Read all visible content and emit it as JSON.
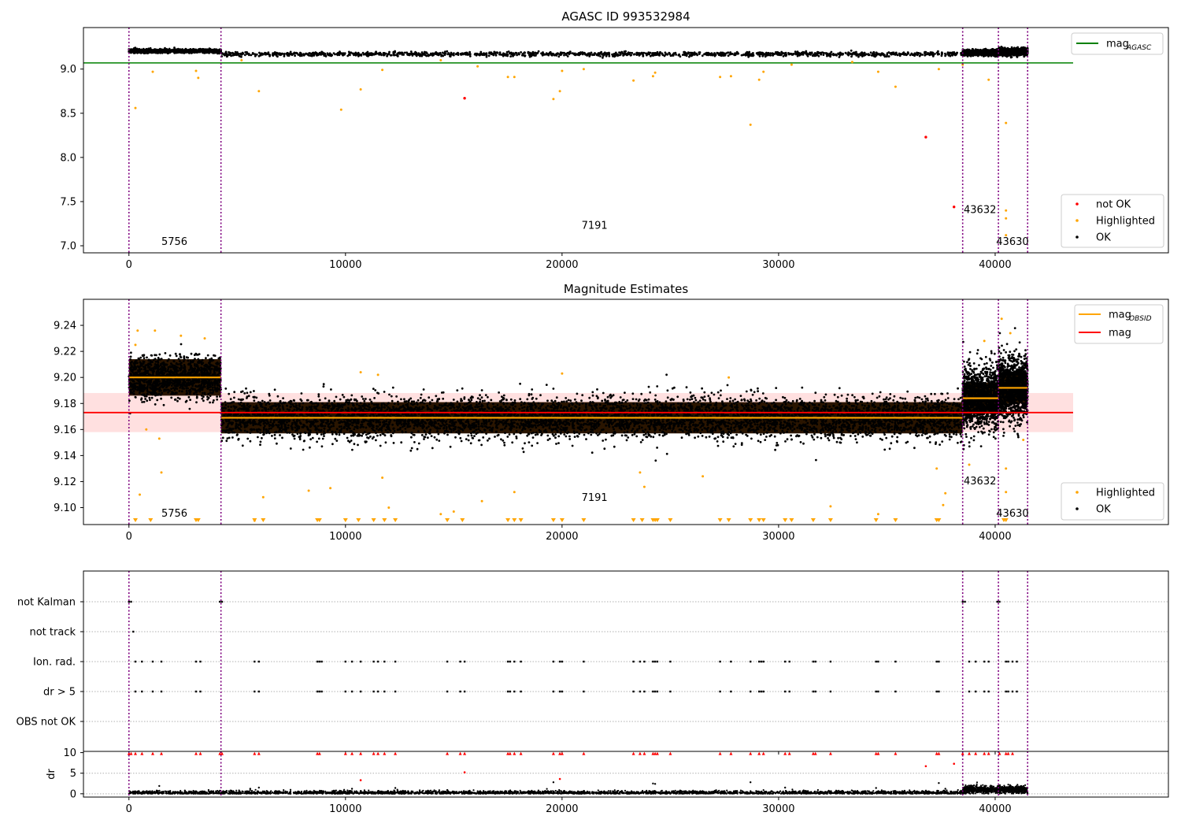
{
  "chart_data": [
    {
      "type": "scatter",
      "title": "AGASC ID 993532984",
      "xlim": [
        -2100,
        48000
      ],
      "ylim": [
        6.92,
        9.47
      ],
      "x_ticks": [
        0,
        10000,
        20000,
        30000,
        40000
      ],
      "y_ticks": [
        7.0,
        7.5,
        8.0,
        8.5,
        9.0
      ],
      "y_tick_format": 1,
      "grid": false,
      "legend_placement": [
        "upper-right",
        "lower-right"
      ],
      "obs_boundaries": [
        0,
        4250,
        38500,
        40150,
        41500
      ],
      "obs_labels": [
        {
          "text": "5756",
          "x": 2100,
          "y": 7.01
        },
        {
          "text": "7191",
          "x": 21500,
          "y": 7.19
        },
        {
          "text": "43632",
          "x": 39300,
          "y": 7.37
        },
        {
          "text": "43630",
          "x": 40800,
          "y": 7.01
        }
      ],
      "reference_lines": [
        {
          "name": "mag",
          "sub": "AGASC",
          "value": 9.07,
          "color": "#008000",
          "x_range": [
            -2100,
            43600
          ]
        }
      ],
      "segments": [
        {
          "x0": 0,
          "x1": 4250,
          "level": 9.205,
          "spread": 0.01
        },
        {
          "x0": 4250,
          "x1": 38500,
          "level": 9.17,
          "spread": 0.012
        },
        {
          "x0": 38500,
          "x1": 40150,
          "level": 9.185,
          "spread": 0.015
        },
        {
          "x0": 40150,
          "x1": 41500,
          "level": 9.195,
          "spread": 0.018
        }
      ],
      "highlighted_points": [
        [
          300,
          8.56
        ],
        [
          1100,
          8.97
        ],
        [
          3100,
          8.98
        ],
        [
          3200,
          8.9
        ],
        [
          5200,
          9.1
        ],
        [
          6000,
          8.75
        ],
        [
          9800,
          8.54
        ],
        [
          10700,
          8.77
        ],
        [
          11700,
          8.99
        ],
        [
          14400,
          9.1
        ],
        [
          16100,
          9.03
        ],
        [
          17500,
          8.91
        ],
        [
          17800,
          8.91
        ],
        [
          19600,
          8.66
        ],
        [
          19900,
          8.75
        ],
        [
          20000,
          8.98
        ],
        [
          21000,
          9.0
        ],
        [
          23300,
          8.87
        ],
        [
          24200,
          8.92
        ],
        [
          24300,
          8.96
        ],
        [
          27300,
          8.91
        ],
        [
          27800,
          8.92
        ],
        [
          28700,
          8.37
        ],
        [
          29100,
          8.88
        ],
        [
          29300,
          8.97
        ],
        [
          30600,
          9.05
        ],
        [
          33400,
          9.08
        ],
        [
          34600,
          8.97
        ],
        [
          35400,
          8.8
        ],
        [
          37400,
          9.0
        ],
        [
          38500,
          9.05
        ],
        [
          39700,
          8.88
        ],
        [
          40500,
          8.39
        ],
        [
          40500,
          7.4
        ],
        [
          40500,
          7.31
        ],
        [
          40500,
          7.12
        ]
      ],
      "not_ok_points": [
        [
          15500,
          8.67
        ],
        [
          36800,
          8.23
        ],
        [
          38100,
          7.44
        ]
      ],
      "series": [
        {
          "name": "not OK",
          "color": "#ff0000"
        },
        {
          "name": "Highlighted",
          "color": "#ffa500"
        },
        {
          "name": "OK",
          "color": "#000000"
        }
      ]
    },
    {
      "type": "scatter",
      "title": "Magnitude Estimates",
      "xlim": [
        -2100,
        48000
      ],
      "ylim": [
        9.087,
        9.26
      ],
      "x_ticks": [
        0,
        10000,
        20000,
        30000,
        40000
      ],
      "y_ticks": [
        9.1,
        9.12,
        9.14,
        9.16,
        9.18,
        9.2,
        9.22,
        9.24
      ],
      "y_tick_format": 2,
      "grid": false,
      "legend_placement": [
        "upper-right",
        "lower-right"
      ],
      "obs_boundaries": [
        0,
        4250,
        38500,
        40150,
        41500
      ],
      "obs_labels": [
        {
          "text": "5756",
          "x": 2100,
          "y": 9.093
        },
        {
          "text": "7191",
          "x": 21500,
          "y": 9.105
        },
        {
          "text": "43632",
          "x": 39300,
          "y": 9.118
        },
        {
          "text": "43630",
          "x": 40800,
          "y": 9.093
        }
      ],
      "mag_band": {
        "low": 9.158,
        "high": 9.188,
        "x_range": [
          -2100,
          43600
        ],
        "color": "#ffcccc"
      },
      "reference_lines": [
        {
          "name": "mag",
          "value": 9.173,
          "color": "#ff0000",
          "x_range": [
            -2100,
            43600
          ]
        }
      ],
      "segments": [
        {
          "x0": 0,
          "x1": 4250,
          "level": 9.2,
          "spread": 0.008,
          "band": 0.014
        },
        {
          "x0": 4250,
          "x1": 38500,
          "level": 9.169,
          "spread": 0.008,
          "band": 0.012
        },
        {
          "x0": 38500,
          "x1": 40150,
          "level": 9.184,
          "spread": 0.012,
          "band": 0.012
        },
        {
          "x0": 40150,
          "x1": 41500,
          "level": 9.192,
          "spread": 0.012,
          "band": 0.012
        }
      ],
      "obsid_mag": {
        "name": "mag",
        "sub": "OBSID",
        "color": "#ffa500"
      },
      "highlighted_points": [
        [
          300,
          9.225
        ],
        [
          400,
          9.236
        ],
        [
          500,
          9.11
        ],
        [
          800,
          9.16
        ],
        [
          1200,
          9.236
        ],
        [
          1400,
          9.153
        ],
        [
          1500,
          9.127
        ],
        [
          2400,
          9.232
        ],
        [
          3500,
          9.23
        ],
        [
          5800,
          9.09
        ],
        [
          6200,
          9.108
        ],
        [
          8300,
          9.113
        ],
        [
          9300,
          9.115
        ],
        [
          10700,
          9.204
        ],
        [
          11500,
          9.202
        ],
        [
          11700,
          9.123
        ],
        [
          12000,
          9.1
        ],
        [
          14400,
          9.095
        ],
        [
          15000,
          9.097
        ],
        [
          16300,
          9.105
        ],
        [
          17800,
          9.112
        ],
        [
          20000,
          9.203
        ],
        [
          23600,
          9.127
        ],
        [
          23800,
          9.116
        ],
        [
          26500,
          9.124
        ],
        [
          27700,
          9.2
        ],
        [
          32400,
          9.101
        ],
        [
          34600,
          9.095
        ],
        [
          37300,
          9.13
        ],
        [
          37600,
          9.102
        ],
        [
          37700,
          9.111
        ],
        [
          38800,
          9.133
        ],
        [
          39500,
          9.228
        ],
        [
          40300,
          9.245
        ],
        [
          40500,
          9.13
        ],
        [
          40500,
          9.112
        ],
        [
          40700,
          9.234
        ],
        [
          41300,
          9.152
        ]
      ],
      "clipped_low_markers": [
        300,
        1000,
        3100,
        3200,
        5800,
        6200,
        8700,
        8800,
        10000,
        10600,
        11300,
        11800,
        12300,
        14700,
        15400,
        17500,
        17800,
        18100,
        19600,
        20000,
        21000,
        23300,
        23700,
        24200,
        24300,
        24400,
        25000,
        27300,
        27700,
        28700,
        29100,
        29300,
        30300,
        30600,
        31600,
        32400,
        34500,
        35400,
        37300,
        37400,
        40400,
        40500
      ],
      "series": [
        {
          "name": "Highlighted",
          "color": "#ffa500"
        },
        {
          "name": "OK",
          "color": "#000000"
        }
      ]
    },
    {
      "type": "scatter",
      "title": "",
      "xlim": [
        -2100,
        48000
      ],
      "x_ticks": [
        0,
        10000,
        20000,
        30000,
        40000
      ],
      "grid": true,
      "obs_boundaries": [
        0,
        4250,
        38500,
        40150,
        41500
      ],
      "flag_categories": [
        "not Kalman",
        "not track",
        "Ion. rad.",
        "dr > 5",
        "OBS not OK"
      ],
      "flag_points": {
        "not Kalman": [
          0,
          100,
          4200,
          4300,
          38500,
          38600,
          40100,
          40200
        ],
        "not track": [
          200
        ],
        "Ion. rad.": [
          300,
          600,
          1100,
          1500,
          3100,
          3300,
          5800,
          6000,
          8700,
          8800,
          8900,
          10000,
          10300,
          10700,
          11300,
          11500,
          11800,
          12300,
          14700,
          15300,
          15500,
          17500,
          17600,
          17800,
          18100,
          19600,
          19900,
          20000,
          21000,
          23300,
          23600,
          23800,
          24200,
          24300,
          24400,
          25000,
          27300,
          27800,
          28700,
          29100,
          29200,
          29300,
          30300,
          30500,
          31600,
          31700,
          32400,
          34500,
          34600,
          35400,
          37300,
          37400,
          38800,
          39100,
          39500,
          39700,
          40500,
          40600,
          40800,
          41000
        ],
        "dr > 5": [
          300,
          600,
          1100,
          1500,
          3100,
          3300,
          5800,
          6000,
          8700,
          8800,
          8900,
          10000,
          10300,
          10700,
          11300,
          11500,
          11800,
          12300,
          14700,
          15300,
          15500,
          17500,
          17600,
          17800,
          18100,
          19600,
          19900,
          20000,
          21000,
          23300,
          23600,
          23800,
          24200,
          24300,
          24400,
          25000,
          27300,
          27800,
          28700,
          29100,
          29200,
          29300,
          30300,
          30500,
          31600,
          31700,
          32400,
          34500,
          34600,
          35400,
          37300,
          37400,
          38800,
          39100,
          39500,
          39700,
          40500,
          40600,
          40800,
          41000
        ],
        "OBS not OK": []
      },
      "dr_panel": {
        "ylabel": "dr",
        "ylim": [
          -0.8,
          10.3
        ],
        "y_ticks": [
          0,
          5,
          10
        ],
        "clip_value": 10,
        "red_clipped_x": [
          0,
          100,
          300,
          600,
          1100,
          1500,
          3100,
          3300,
          4200,
          4300,
          5800,
          6000,
          8700,
          8800,
          10000,
          10300,
          10700,
          11300,
          11500,
          11800,
          12300,
          14700,
          15300,
          15500,
          17500,
          17600,
          17800,
          18100,
          19600,
          19900,
          20000,
          21000,
          23300,
          23600,
          23800,
          24200,
          24300,
          24400,
          25000,
          27300,
          27800,
          28700,
          29100,
          29300,
          30300,
          30500,
          31600,
          31700,
          32400,
          34500,
          34600,
          35400,
          37300,
          37400,
          38500,
          38800,
          39100,
          39500,
          39700,
          40200,
          40500,
          40600,
          40800
        ],
        "red_points": [
          [
            10700,
            3.3
          ],
          [
            15500,
            5.2
          ],
          [
            19900,
            3.6
          ],
          [
            36800,
            6.7
          ],
          [
            38100,
            7.3
          ]
        ],
        "black_spikes": [
          [
            1400,
            1.9
          ],
          [
            5600,
            1.2
          ],
          [
            6000,
            1.5
          ],
          [
            10300,
            1.2
          ],
          [
            12300,
            1.4
          ],
          [
            14700,
            0.9
          ],
          [
            19600,
            2.8
          ],
          [
            24200,
            2.5
          ],
          [
            24300,
            2.4
          ],
          [
            28700,
            2.8
          ],
          [
            30300,
            1.5
          ],
          [
            34500,
            1.4
          ],
          [
            37400,
            2.6
          ],
          [
            37700,
            1.2
          ]
        ],
        "segments": [
          {
            "x0": 0,
            "x1": 38500,
            "level": 0.25,
            "spread": 0.25
          },
          {
            "x0": 38500,
            "x1": 41500,
            "level": 1.0,
            "spread": 0.45
          }
        ]
      }
    }
  ]
}
